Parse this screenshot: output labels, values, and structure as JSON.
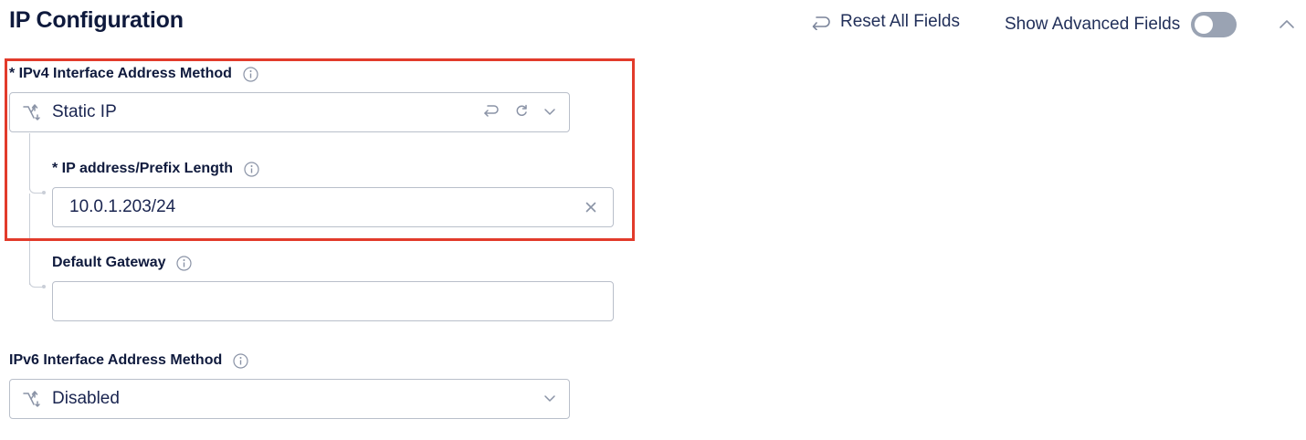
{
  "header": {
    "title": "IP Configuration",
    "reset_label": "Reset All Fields",
    "advanced_label": "Show Advanced Fields",
    "advanced_enabled": false
  },
  "ipv4": {
    "label": "* IPv4 Interface Address Method",
    "value": "Static IP",
    "icon": "branch-icon"
  },
  "ip_prefix": {
    "label": "* IP address/Prefix Length",
    "value": "10.0.1.203/24"
  },
  "gateway": {
    "label": "Default Gateway",
    "value": ""
  },
  "ipv6": {
    "label": "IPv6 Interface Address Method",
    "value": "Disabled",
    "icon": "branch-icon"
  },
  "colors": {
    "highlight": "#e23b2b",
    "text": "#0f1a3d",
    "toggle_off": "#9aa3b3"
  }
}
